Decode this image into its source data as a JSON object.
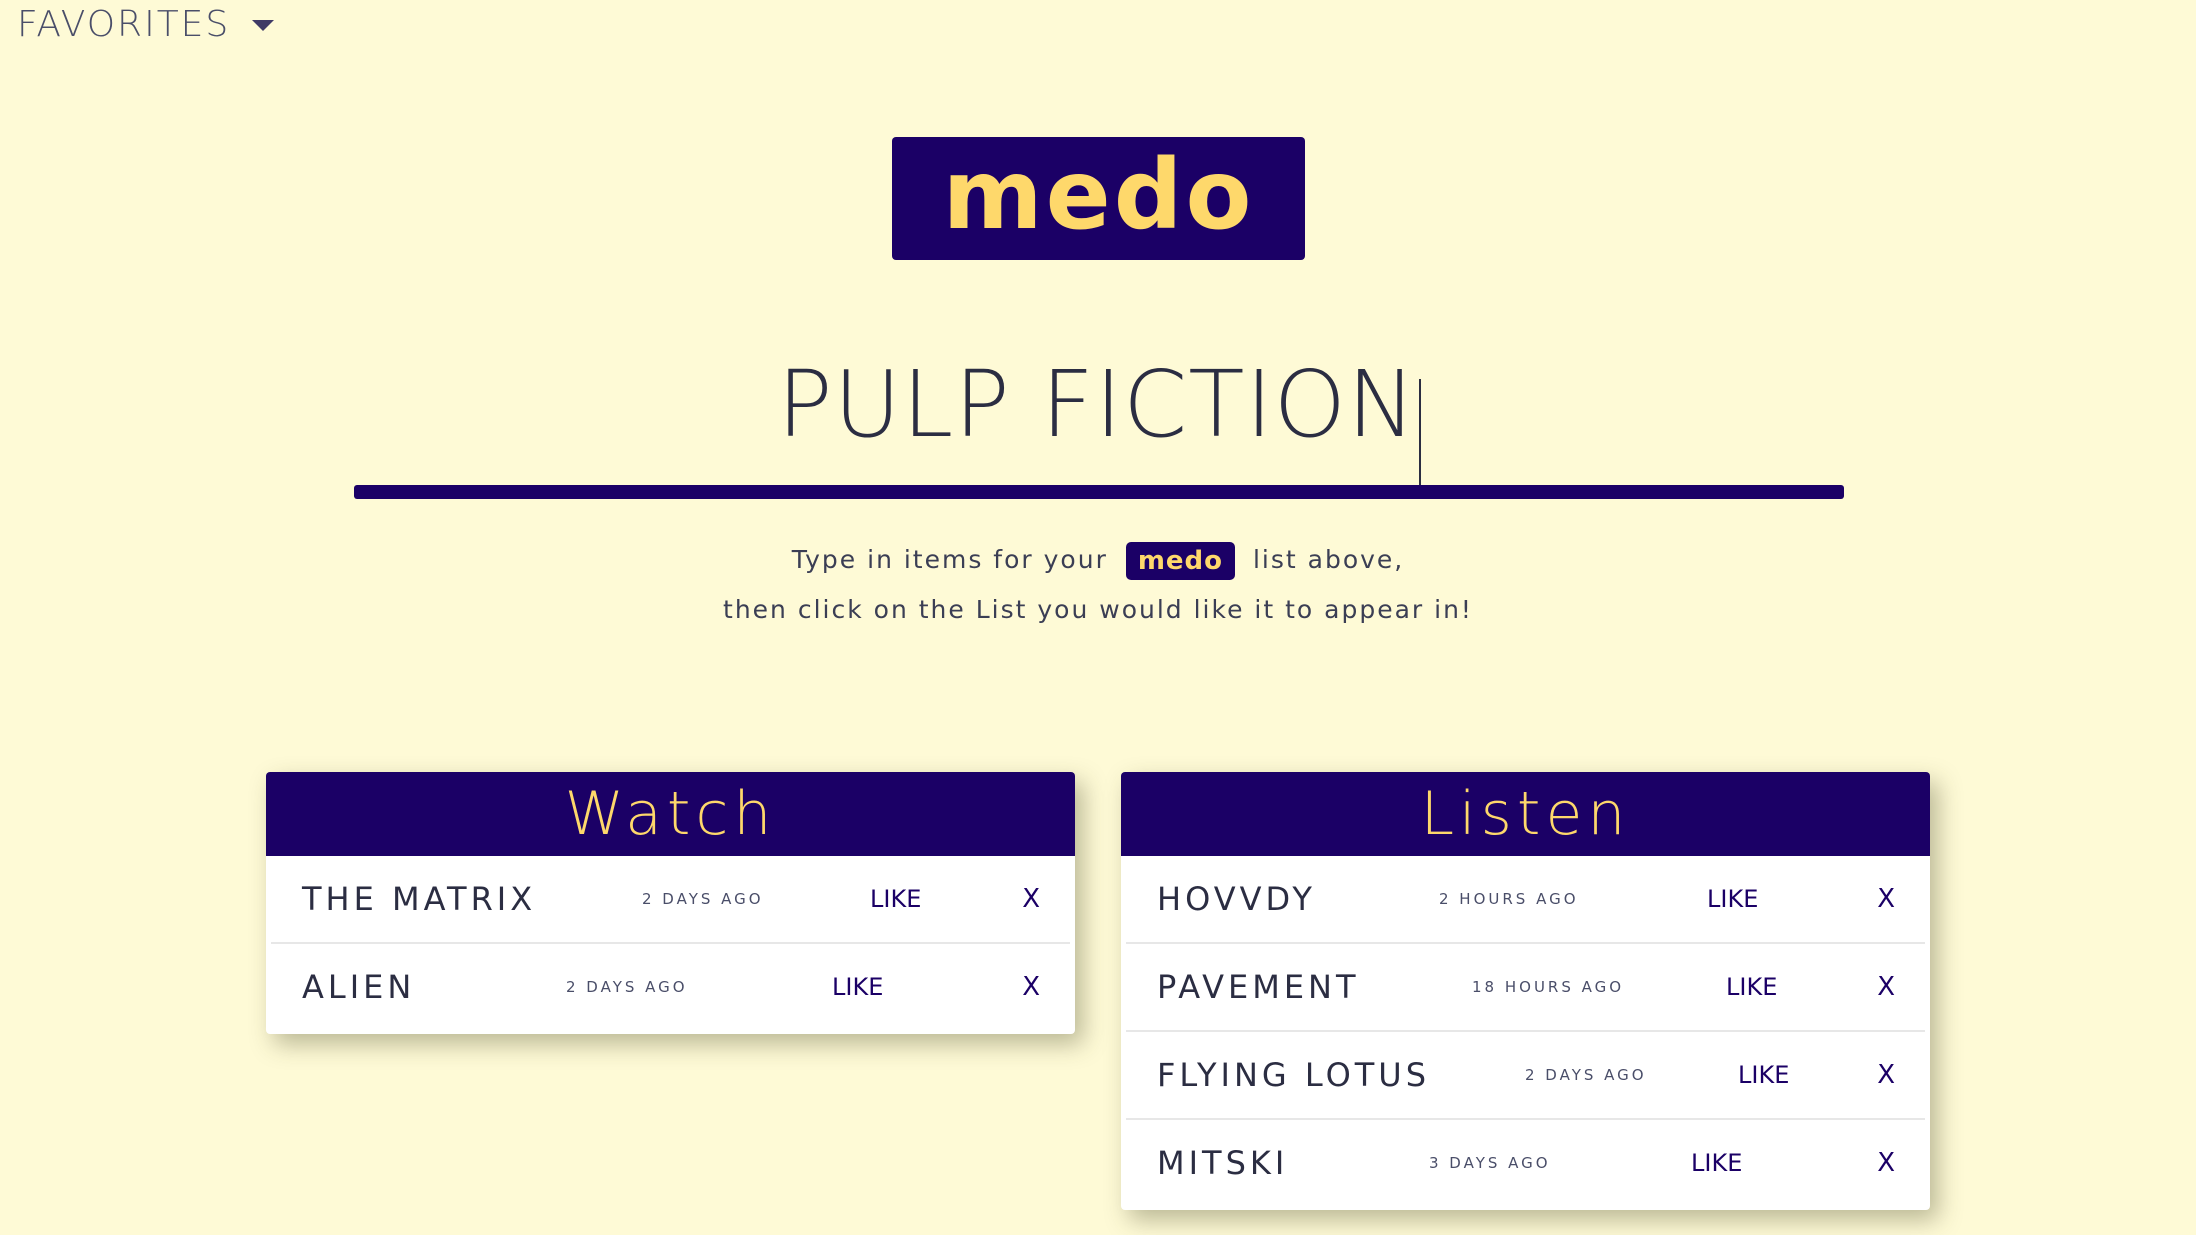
{
  "favorites": {
    "label": "FAVORITES"
  },
  "logo": {
    "text": "medo"
  },
  "input": {
    "value": "PULP FICTION"
  },
  "instructions": {
    "before": "Type in items for your",
    "logo": "medo",
    "after": "list above,",
    "line2": "then click on the List you would like it to appear in!"
  },
  "lists": [
    {
      "title": "Watch",
      "items": [
        {
          "name": "THE MATRIX",
          "time": "2 DAYS AGO",
          "like": "LIKE",
          "remove": "X"
        },
        {
          "name": "ALIEN",
          "time": "2 DAYS AGO",
          "like": "LIKE",
          "remove": "X"
        }
      ]
    },
    {
      "title": "Listen",
      "items": [
        {
          "name": "HOVVDY",
          "time": "2 HOURS AGO",
          "like": "LIKE",
          "remove": "X"
        },
        {
          "name": "PAVEMENT",
          "time": "18 HOURS AGO",
          "like": "LIKE",
          "remove": "X"
        },
        {
          "name": "FLYING LOTUS",
          "time": "2 DAYS AGO",
          "like": "LIKE",
          "remove": "X"
        },
        {
          "name": "MITSKI",
          "time": "3 DAYS AGO",
          "like": "LIKE",
          "remove": "X"
        }
      ]
    }
  ],
  "colors": {
    "background": "#fefad6",
    "brand_navy": "#1b0066",
    "brand_yellow": "#fed86b"
  }
}
